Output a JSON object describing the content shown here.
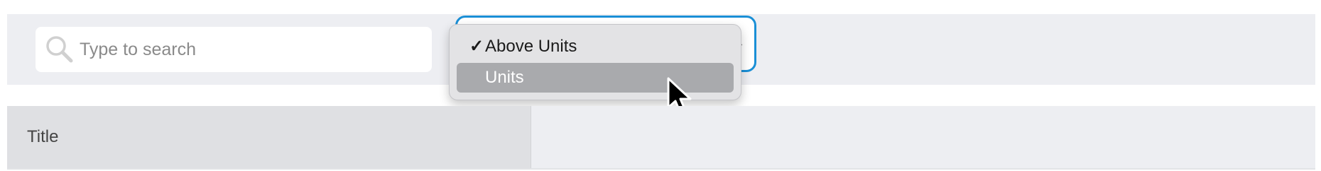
{
  "search": {
    "placeholder": "Type to search",
    "value": "",
    "icon": "search-icon"
  },
  "select": {
    "options": [
      {
        "label": "Above Units",
        "checked": true
      },
      {
        "label": "Units",
        "checked": false,
        "highlighted": true
      }
    ],
    "check_glyph": "✓"
  },
  "table": {
    "columns": [
      "Title"
    ]
  },
  "colors": {
    "focus_ring": "#1a8fd6",
    "toolbar_bg": "#edeef2",
    "highlight": "#a9aaad",
    "menu_bg": "#e3e3e5"
  }
}
